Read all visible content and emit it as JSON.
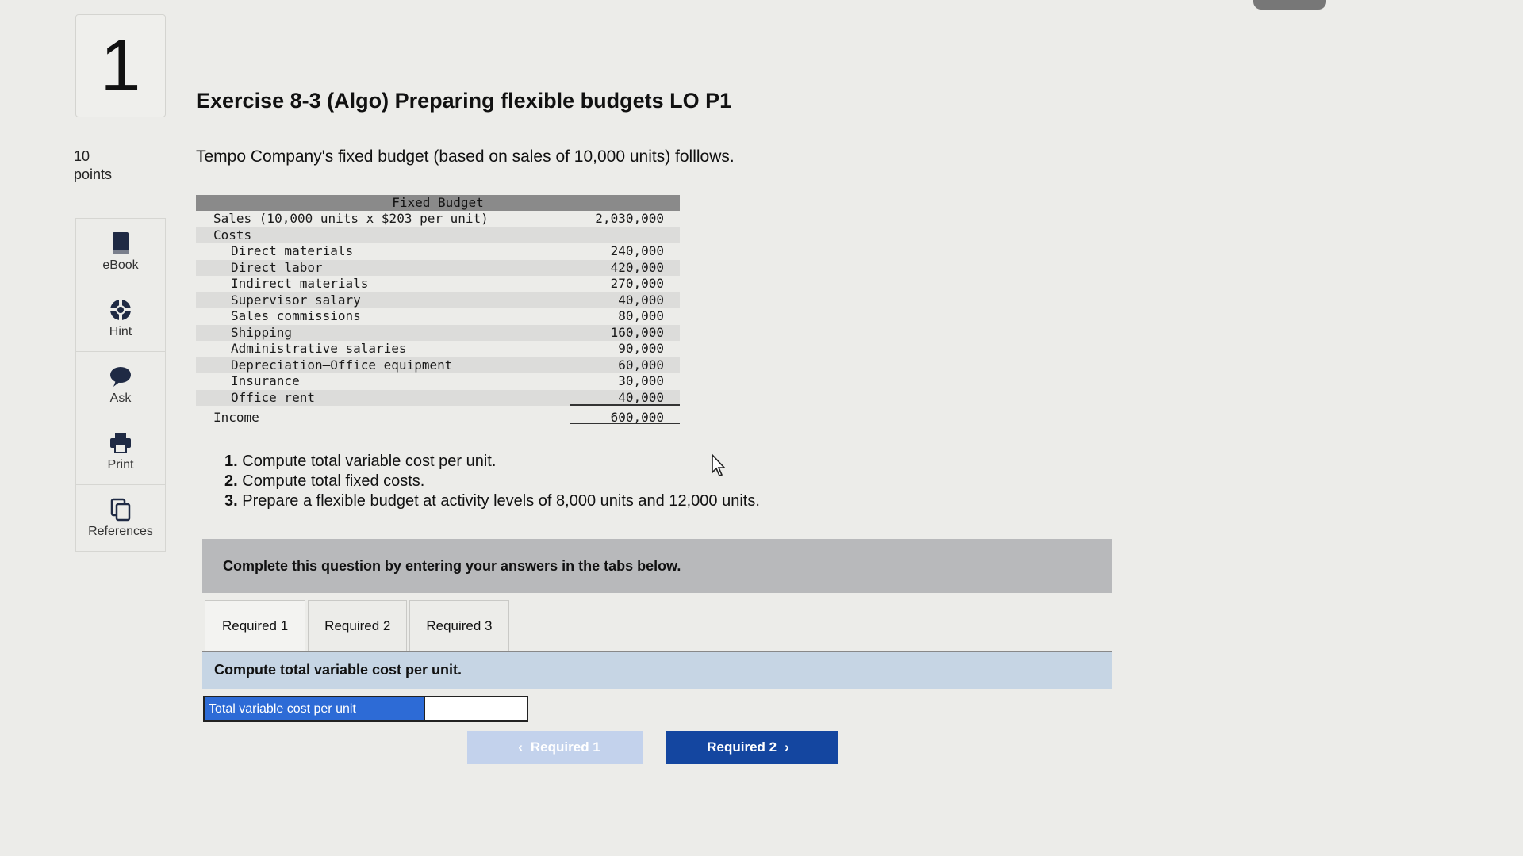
{
  "question": {
    "number": "1",
    "points_value": "10",
    "points_label": "points"
  },
  "tools": [
    {
      "label": "eBook",
      "icon": "ebook-icon"
    },
    {
      "label": "Hint",
      "icon": "hint-icon"
    },
    {
      "label": "Ask",
      "icon": "ask-icon"
    },
    {
      "label": "Print",
      "icon": "print-icon"
    },
    {
      "label": "References",
      "icon": "references-icon"
    }
  ],
  "title": "Exercise 8-3 (Algo) Preparing flexible budgets LO P1",
  "intro": "Tempo Company's fixed budget (based on sales of 10,000 units) folllows.",
  "budget": {
    "header": "Fixed Budget",
    "sales": {
      "label": "Sales (10,000 units x $203 per unit)",
      "value": "2,030,000"
    },
    "costs_label": "Costs",
    "costs": [
      {
        "label": "Direct materials",
        "value": "240,000"
      },
      {
        "label": "Direct labor",
        "value": "420,000"
      },
      {
        "label": "Indirect materials",
        "value": "270,000"
      },
      {
        "label": "Supervisor salary",
        "value": "40,000"
      },
      {
        "label": "Sales commissions",
        "value": "80,000"
      },
      {
        "label": "Shipping",
        "value": "160,000"
      },
      {
        "label": "Administrative salaries",
        "value": "90,000"
      },
      {
        "label": "Depreciation—Office equipment",
        "value": "60,000"
      },
      {
        "label": "Insurance",
        "value": "30,000"
      },
      {
        "label": "Office rent",
        "value": "40,000"
      }
    ],
    "income": {
      "label": "Income",
      "value": "600,000"
    }
  },
  "tasks": [
    {
      "num": "1.",
      "text": "Compute total variable cost per unit."
    },
    {
      "num": "2.",
      "text": "Compute total fixed costs."
    },
    {
      "num": "3.",
      "text": "Prepare a flexible budget at activity levels of 8,000 units and 12,000 units."
    }
  ],
  "banner": "Complete this question by entering your answers in the tabs below.",
  "tabs": [
    "Required 1",
    "Required 2",
    "Required 3"
  ],
  "instruction": "Compute total variable cost per unit.",
  "answer": {
    "label": "Total variable cost per unit",
    "value": ""
  },
  "nav": {
    "prev_label": "Required 1",
    "next_label": "Required 2"
  },
  "colors": {
    "next_button": "#1446a0",
    "answer_label_bg": "#2d6bd6",
    "instruction_bg": "#c6d5e4",
    "banner_bg": "#b8b9bb"
  }
}
